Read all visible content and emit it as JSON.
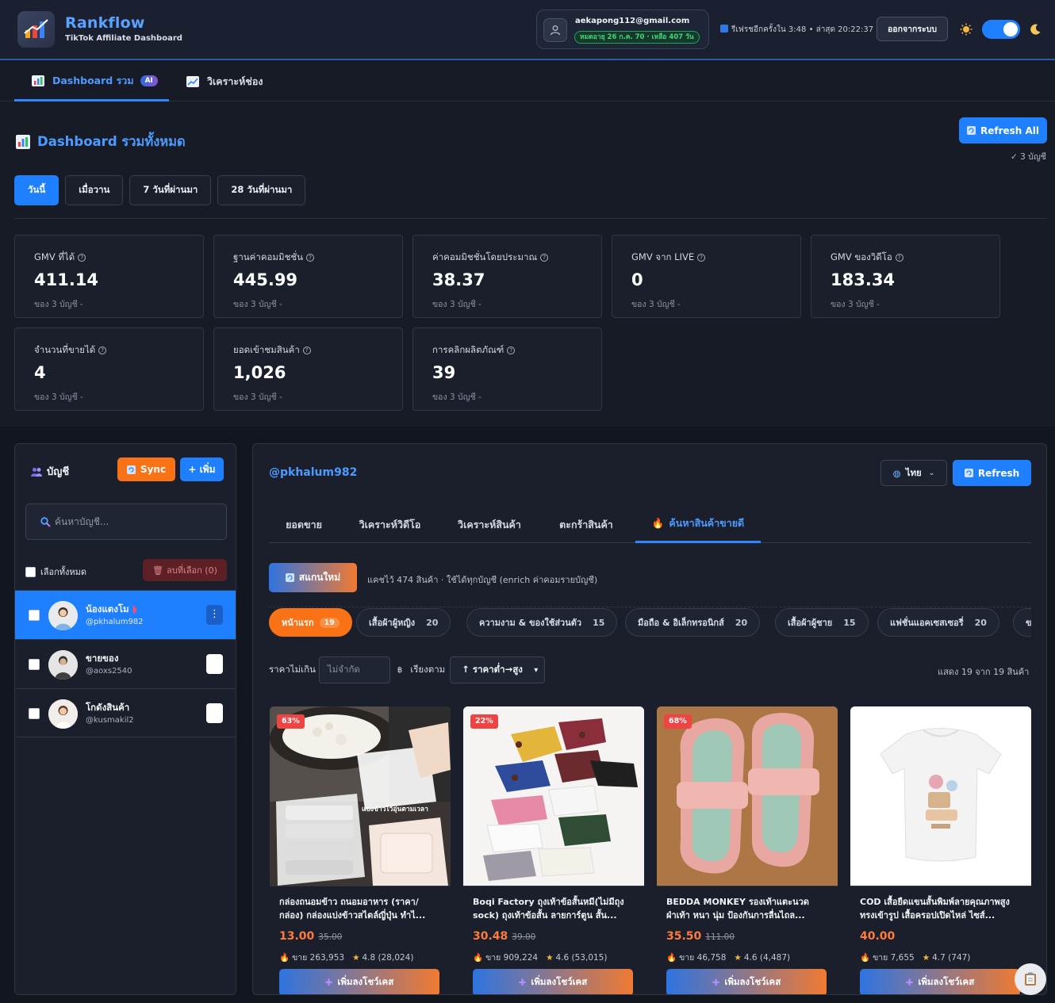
{
  "app": {
    "brand": "Rankflow",
    "subtitle": "TikTok Affiliate Dashboard"
  },
  "user": {
    "email": "aekapong112@gmail.com",
    "expiry": "หมดอายุ 26 ก.ค. 70 · เหลือ 407 วัน"
  },
  "header": {
    "refresh_info": "รีเฟรชอีกครั้งใน 3:48 • ล่าสุด 20:22:37",
    "logout": "ออกจากระบบ"
  },
  "nav": {
    "dashboard": "Dashboard รวม",
    "ai_badge": "AI",
    "channel": "วิเคราะห์ช่อง"
  },
  "dashboard": {
    "title": "Dashboard รวมทั้งหมด",
    "refresh_all": "Refresh All",
    "account_count": "✓ 3 บัญชี",
    "periods": [
      "วันนี้",
      "เมื่อวาน",
      "7 วันที่ผ่านมา",
      "28 วันที่ผ่านมา"
    ],
    "stats": [
      {
        "label": "GMV ที่ได้",
        "value": "411.14",
        "sub": "ของ 3 บัญชี -"
      },
      {
        "label": "ฐานค่าคอมมิชชั่น",
        "value": "445.99",
        "sub": "ของ 3 บัญชี -"
      },
      {
        "label": "ค่าคอมมิชชั่นโดยประมาณ",
        "value": "38.37",
        "sub": "ของ 3 บัญชี -"
      },
      {
        "label": "GMV จาก LIVE",
        "value": "0",
        "sub": "ของ 3 บัญชี -"
      },
      {
        "label": "GMV ของวิดีโอ",
        "value": "183.34",
        "sub": "ของ 3 บัญชี -"
      },
      {
        "label": "จำนวนที่ขายได้",
        "value": "4",
        "sub": "ของ 3 บัญชี -"
      },
      {
        "label": "ยอดเข้าชมสินค้า",
        "value": "1,026",
        "sub": "ของ 3 บัญชี -"
      },
      {
        "label": "การคลิกผลิตภัณฑ์",
        "value": "39",
        "sub": "ของ 3 บัญชี -"
      }
    ]
  },
  "sidebar": {
    "title": "บัญชี",
    "sync": "Sync",
    "add": "+ เพิ่ม",
    "search_placeholder": "ค้นหาบัญชี...",
    "select_all": "เลือกทั้งหมด",
    "delete_selected": "ลบที่เลือก (0)",
    "accounts": [
      {
        "name": "น้องแตงโม",
        "handle": "@pkhalum982"
      },
      {
        "name": "ขายของ",
        "handle": "@aoxs2540"
      },
      {
        "name": "โกดังสินค้า",
        "handle": "@kusmakil2"
      }
    ]
  },
  "main": {
    "handle": "@pkhalum982",
    "language": "ไทย",
    "refresh": "Refresh",
    "tabs": [
      "ยอดขาย",
      "วิเคราะห์วิดีโอ",
      "วิเคราะห์สินค้า",
      "ตะกร้าสินค้า",
      "ค้นหาสินค้าขายดี"
    ],
    "scan": "สแกนใหม่",
    "cache_info": "แคชไว้ 474 สินค้า · ใช้ได้ทุกบัญชี (enrich ค่าคอมรายบัญชี)",
    "categories": [
      {
        "label": "หน้าแรก",
        "count": "19"
      },
      {
        "label": "เสื้อผ้าผู้หญิง",
        "count": "20"
      },
      {
        "label": "ความงาม & ของใช้ส่วนตัว",
        "count": "15"
      },
      {
        "label": "มือถือ & อิเล็กทรอนิกส์",
        "count": "20"
      },
      {
        "label": "เสื้อผ้าผู้ชาย",
        "count": "15"
      },
      {
        "label": "แฟชั่นแอคเซสเซอรี่",
        "count": "20"
      },
      {
        "label": "ข",
        "count": ""
      }
    ],
    "price_label": "ราคาไม่เกิน",
    "price_placeholder": "ไม่จำกัด",
    "currency": "฿",
    "sort_label": "เรียงตาม",
    "sort_value": "↑ ราคาต่ำ→สูง",
    "showing": "แสดง 19 จาก 19 สินค้า",
    "products": [
      {
        "discount": "63%",
        "title": "กล่องถนอมข้าว ถนอมอาหาร (ราคา/กล่อง) กล่องแบ่งข้าวสไตล์ญี่ปุ่น ทำไ...",
        "price": "13.00",
        "old_price": "35.00",
        "sold": "ขาย 263,953",
        "rating": "4.8 (28,024)",
        "overlay_text": "แบ่งข้าวไว้อุ่นตามเวลา"
      },
      {
        "discount": "22%",
        "title": "Boqi Factory ถุงเท้าข้อสั้นหมี(ไม่มีถุง sock) ถุงเท้าข้อสั้น ลายการ์ตูน สั้น...",
        "price": "30.48",
        "old_price": "39.00",
        "sold": "ขาย 909,224",
        "rating": "4.6 (53,015)"
      },
      {
        "discount": "68%",
        "title": "BEDDA MONKEY รองเท้าแตะนวด ฝ่าเท้า หนา นุ่ม ป้องกันการลื่นไถล...",
        "price": "35.50",
        "old_price": "111.00",
        "sold": "ขาย 46,758",
        "rating": "4.6 (4,487)"
      },
      {
        "discount": "",
        "title": "COD เสื้อยืดแขนสั้นพิมพ์ลายคุณภาพสูง ทรงเข้ารูป เสื้อครอปเปิดไหล่ ไซส์...",
        "price": "40.00",
        "old_price": "",
        "sold": "ขาย 7,655",
        "rating": "4.7 (747)"
      }
    ],
    "add_to_showcase": "เพิ่มลงโชว์เคส"
  },
  "colors": {
    "accent": "#1f80ff",
    "orange": "#f97316",
    "background": "#161b25",
    "card": "#1a1f2b"
  }
}
